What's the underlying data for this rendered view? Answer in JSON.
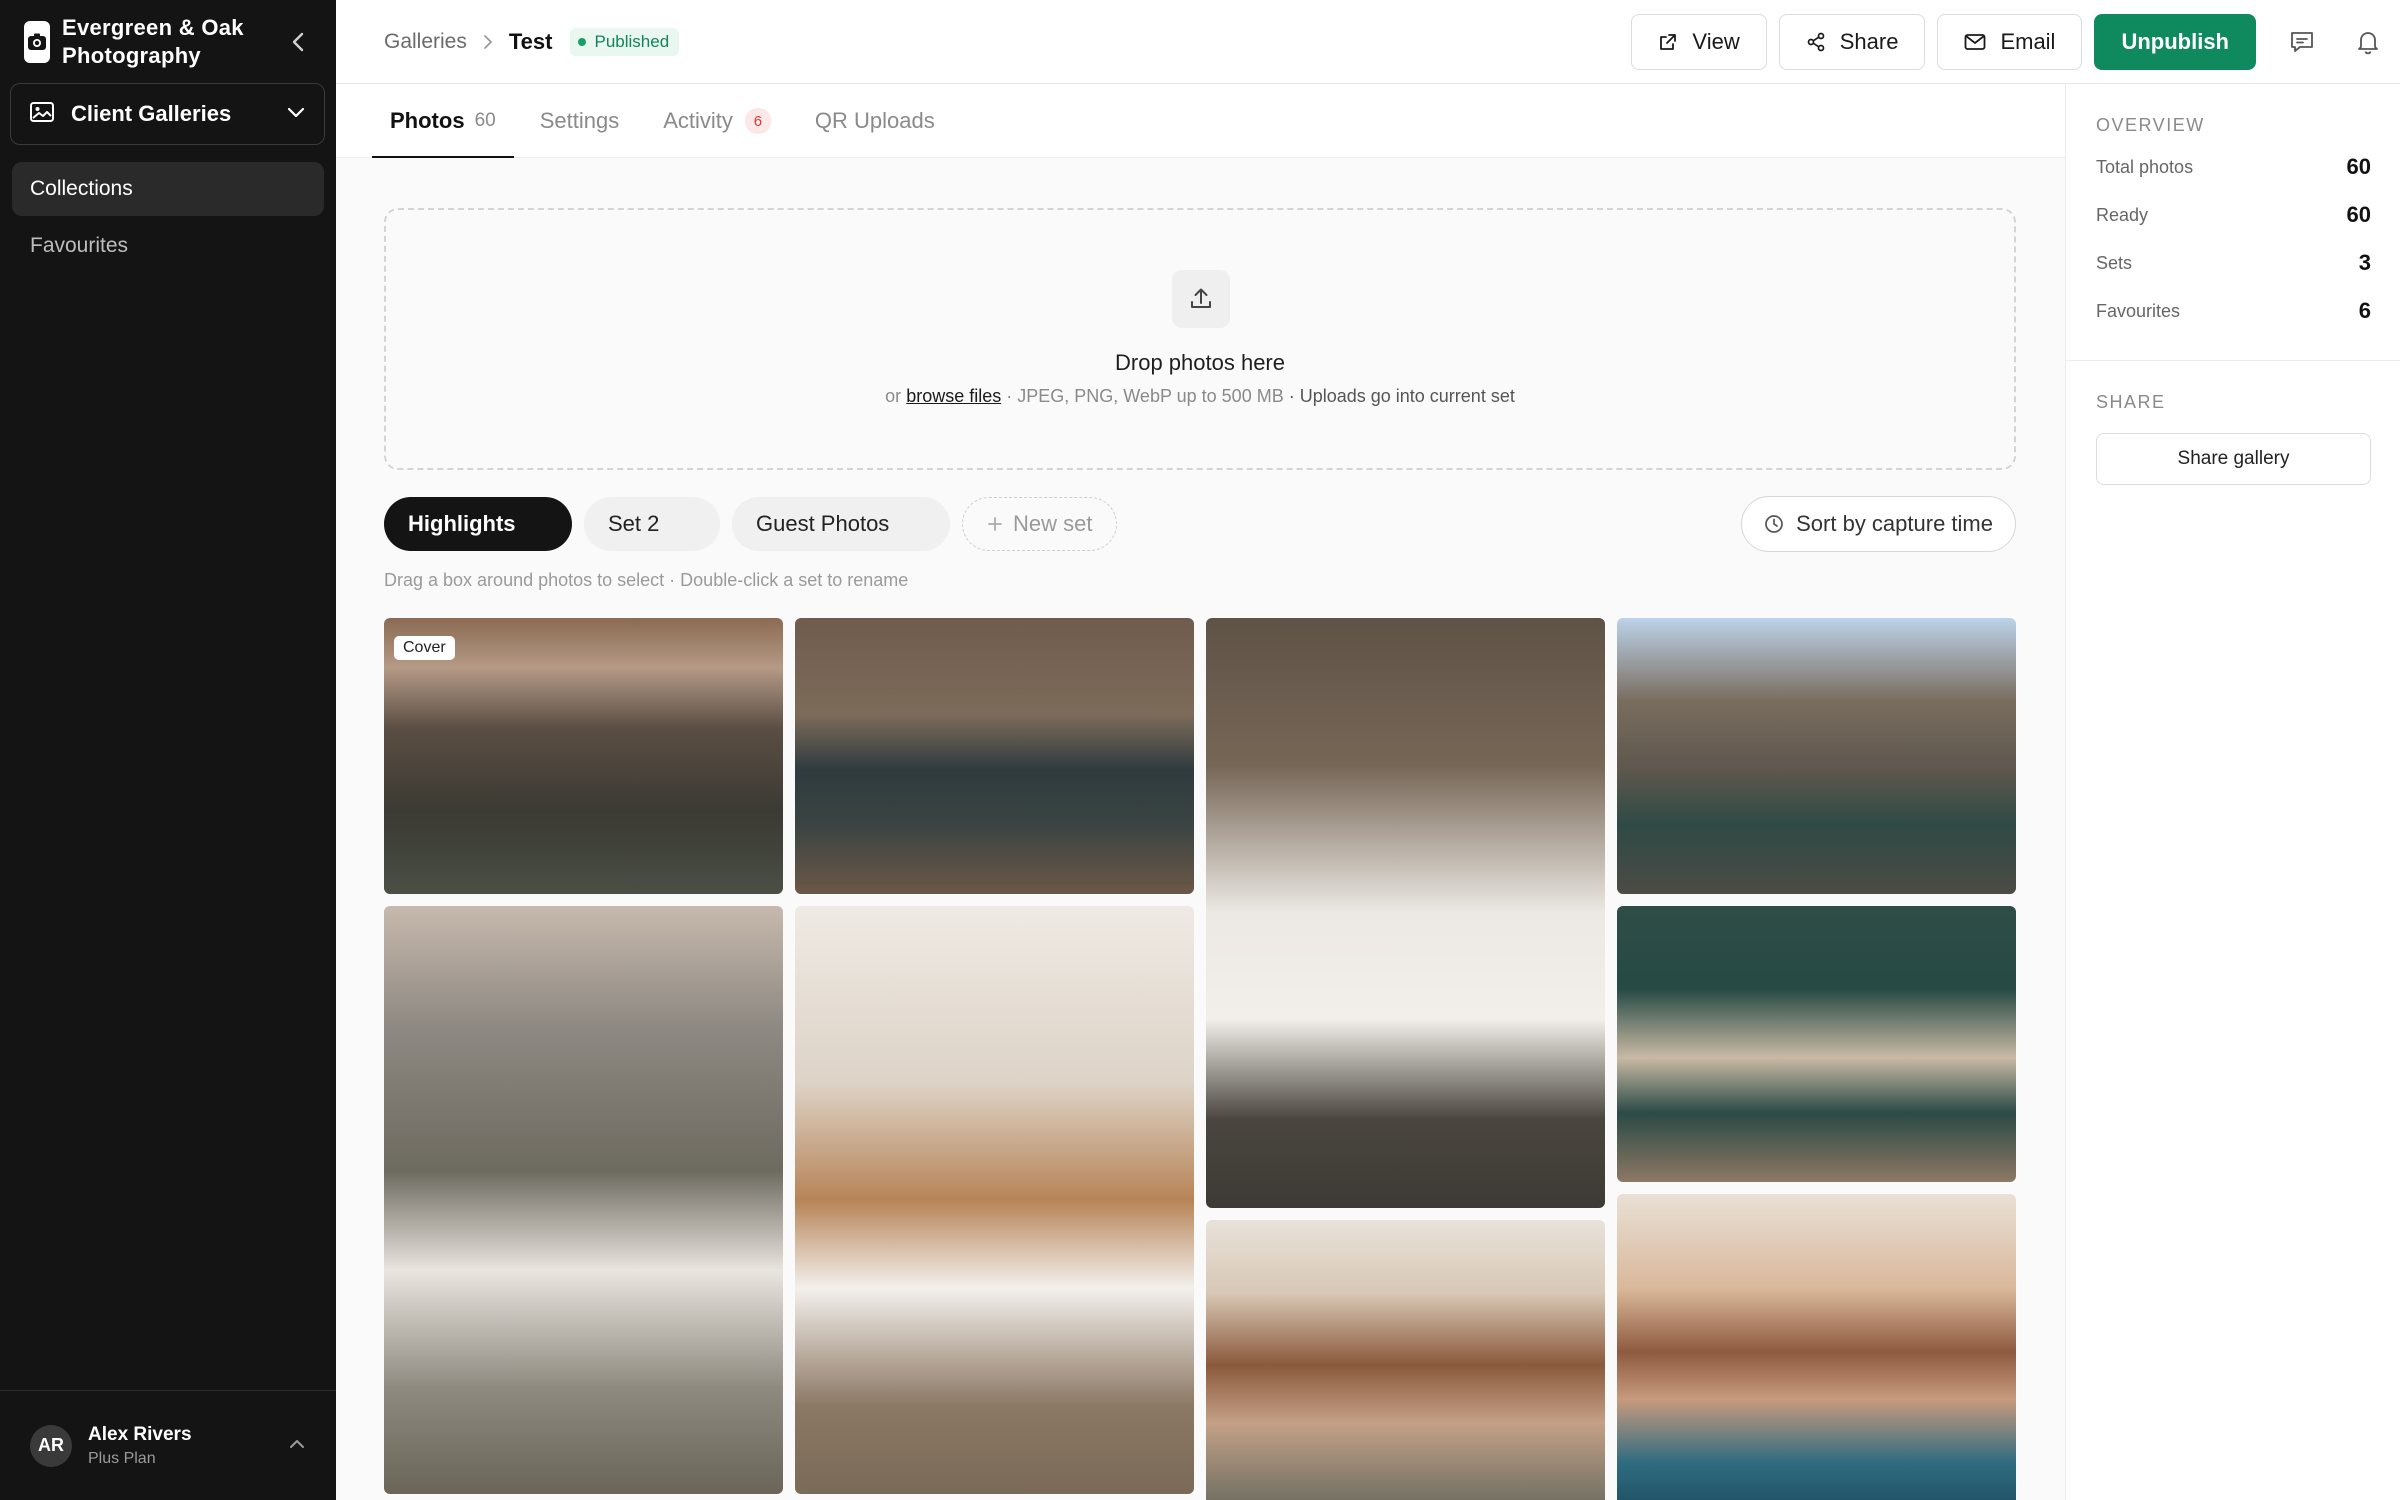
{
  "brand": {
    "name": "Evergreen & Oak Photography"
  },
  "sidebar": {
    "workspace": "Client Galleries",
    "items": [
      {
        "label": "Collections",
        "active": true
      },
      {
        "label": "Favourites",
        "active": false
      }
    ],
    "user": {
      "initials": "AR",
      "name": "Alex Rivers",
      "plan": "Plus Plan"
    }
  },
  "header": {
    "breadcrumb_root": "Galleries",
    "breadcrumb_current": "Test",
    "status": "Published",
    "actions": {
      "view": "View",
      "share": "Share",
      "email": "Email",
      "unpublish": "Unpublish"
    }
  },
  "tabs": [
    {
      "label": "Photos",
      "count": "60"
    },
    {
      "label": "Settings"
    },
    {
      "label": "Activity",
      "badge": "6"
    },
    {
      "label": "QR Uploads"
    }
  ],
  "dropzone": {
    "title": "Drop photos here",
    "prefix": "or",
    "link": "browse files",
    "formats": "· JPEG, PNG, WebP up to 500 MB",
    "tail": "· Uploads go into current set"
  },
  "sets": {
    "items": [
      "Highlights",
      "Set 2",
      "Guest Photos"
    ],
    "new_label": "New set",
    "sort_label": "Sort by capture time",
    "hint": "Drag a box around photos to select · Double-click a set to rename"
  },
  "photos": {
    "cover_label": "Cover"
  },
  "overview": {
    "title": "OVERVIEW",
    "rows": [
      {
        "label": "Total photos",
        "value": "60"
      },
      {
        "label": "Ready",
        "value": "60"
      },
      {
        "label": "Sets",
        "value": "3"
      },
      {
        "label": "Favourites",
        "value": "6"
      }
    ]
  },
  "share": {
    "title": "SHARE",
    "button": "Share gallery"
  },
  "colors": {
    "accent": "#0f8a5f",
    "sidebar_bg": "#141414",
    "badge_red": "#d33c3c"
  }
}
